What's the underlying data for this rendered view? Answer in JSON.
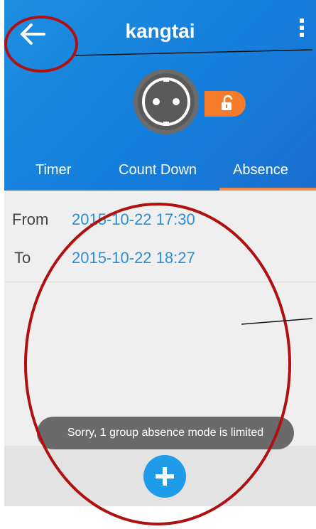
{
  "header": {
    "title": "kangtai",
    "back_icon": "back-arrow-icon",
    "menu_icon": "overflow-menu-icon",
    "lock_icon": "lock-open-icon"
  },
  "tabs": [
    {
      "label": "Timer"
    },
    {
      "label": "Count Down"
    },
    {
      "label": "Absence",
      "active": true
    }
  ],
  "schedule": {
    "from_label": "From",
    "from_value": "2015-10-22 17:30",
    "to_label": "To",
    "to_value": "2015-10-22 18:27"
  },
  "toast": {
    "message": "Sorry, 1 group absence mode is limited"
  },
  "footer": {
    "add_icon": "plus-icon"
  },
  "colors": {
    "header_blue": "#157fdd",
    "accent_orange": "#f57c2a",
    "link_blue": "#2a8fd6",
    "annotation_red": "#b01010"
  }
}
